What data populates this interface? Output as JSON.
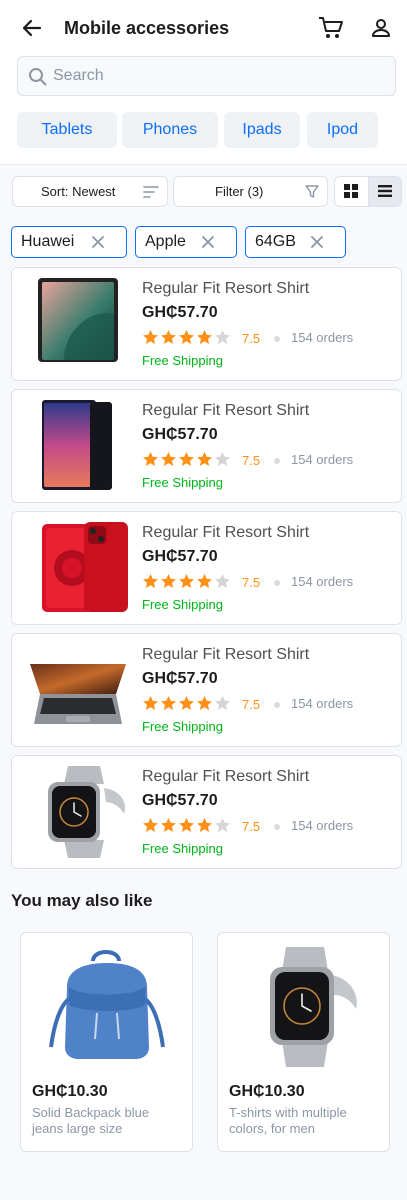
{
  "header": {
    "title": "Mobile accessories",
    "back_icon": "arrow-left-icon",
    "cart_icon": "cart-icon",
    "user_icon": "user-icon"
  },
  "search": {
    "placeholder": "Search",
    "value": ""
  },
  "categories": [
    "Tablets",
    "Phones",
    "Ipads",
    "Ipod"
  ],
  "toolbar": {
    "sort_label": "Sort: Newest",
    "filter_label": "Filter (3)"
  },
  "active_filters": [
    "Huawei",
    "Apple",
    "64GB"
  ],
  "products": [
    {
      "name": "Regular Fit Resort Shirt",
      "price": "GH₵57.70",
      "rating": "7.5",
      "stars": 4,
      "orders": "154 orders",
      "shipping": "Free Shipping",
      "image": "tablet"
    },
    {
      "name": "Regular Fit Resort Shirt",
      "price": "GH₵57.70",
      "rating": "7.5",
      "stars": 4,
      "orders": "154 orders",
      "shipping": "Free Shipping",
      "image": "phone-blue"
    },
    {
      "name": "Regular Fit Resort Shirt",
      "price": "GH₵57.70",
      "rating": "7.5",
      "stars": 4,
      "orders": "154 orders",
      "shipping": "Free Shipping",
      "image": "phone-red"
    },
    {
      "name": "Regular Fit Resort Shirt",
      "price": "GH₵57.70",
      "rating": "7.5",
      "stars": 4,
      "orders": "154 orders",
      "shipping": "Free Shipping",
      "image": "laptop"
    },
    {
      "name": "Regular Fit Resort Shirt",
      "price": "GH₵57.70",
      "rating": "7.5",
      "stars": 4,
      "orders": "154 orders",
      "shipping": "Free Shipping",
      "image": "smartwatch"
    }
  ],
  "recommendations": {
    "title": "You may also like",
    "items": [
      {
        "price": "GH₵10.30",
        "description": "Solid Backpack blue jeans large size",
        "image": "backpack"
      },
      {
        "price": "GH₵10.30",
        "description": "T-shirts with multiple colors, for men",
        "image": "smartwatch"
      }
    ]
  },
  "colors": {
    "accent": "#0d6efd",
    "star": "#ff9017",
    "shipping": "#00b517",
    "muted": "#8b96a5"
  }
}
